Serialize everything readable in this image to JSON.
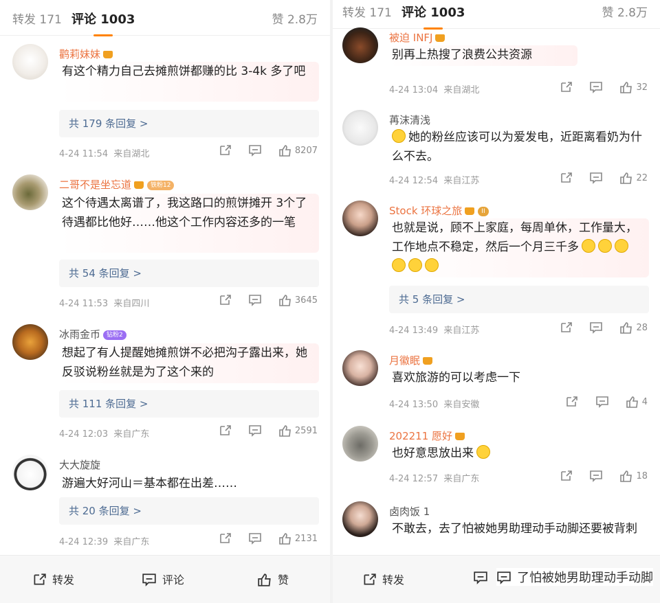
{
  "left": {
    "tabs": {
      "repost": "转发 171",
      "comments": "评论 1003",
      "likes": "赞 2.8万"
    },
    "comments": [
      {
        "user": "鹳莉妹妹",
        "text": "有这个精力自己去摊煎饼都赚的比 3-4k 多了吧",
        "replies": "共 179 条回复 >",
        "time": "4-24 11:54",
        "from": "来自湖北",
        "likes": "8207"
      },
      {
        "user": "二哥不是坐忘道",
        "badge": "铁粉12",
        "text": "这个待遇太离谱了，我这路口的煎饼摊开 3个了待遇都比他好……他这个工作内容还多的一笔",
        "replies": "共 54 条回复 >",
        "time": "4-24 11:53",
        "from": "来自四川",
        "likes": "3645"
      },
      {
        "user": "冰雨金币",
        "badge": "钻粉2",
        "text": "想起了有人提醒她摊煎饼不必把沟子露出来，她反驳说粉丝就是为了这个来的",
        "replies": "共 111 条回复 >",
        "time": "4-24 12:03",
        "from": "来自广东",
        "likes": "2591"
      },
      {
        "user": "大大旋旋",
        "text": "游遍大好河山＝基本都在出差……",
        "replies": "共 20 条回复 >",
        "time": "4-24 12:39",
        "from": "来自广东",
        "likes": "2131"
      }
    ],
    "footer": {
      "repost": "转发",
      "comment": "评论",
      "like": "赞"
    }
  },
  "right": {
    "tabs": {
      "repost": "转发 171",
      "comments": "评论 1003",
      "likes": "赞 2.8万"
    },
    "comments": [
      {
        "user": "被迫 INFJ",
        "text": "别再上热搜了浪费公共资源",
        "time": "4-24 13:04",
        "from": "来自湖北",
        "likes": "32"
      },
      {
        "user": "苒沫清浅",
        "text": "她的粉丝应该可以为爱发电，近距离看奶为什么不去。",
        "time": "4-24 12:54",
        "from": "来自江苏",
        "likes": "22"
      },
      {
        "user": "Stock 环球之旅",
        "badge": "II",
        "text": "也就是说，顾不上家庭，每周单休，工作量大，工作地点不稳定，然后一个月三千多",
        "replies": "共 5 条回复 >",
        "time": "4-24 13:49",
        "from": "来自江苏",
        "likes": "28"
      },
      {
        "user": "月徽眠",
        "text": "喜欢旅游的可以考虑一下",
        "time": "4-24 13:50",
        "from": "来自安徽",
        "likes": "4"
      },
      {
        "user": "202211 愿好",
        "text": "也好意思放出来",
        "time": "4-24 12:57",
        "from": "来自广东",
        "likes": "18"
      },
      {
        "user": "卤肉饭 1",
        "text": "不敢去，去了怕被她男助理动手动脚还要被背刺"
      }
    ],
    "footer": {
      "repost": "转发",
      "comment_preview": "了怕被她男助理动手动脚"
    }
  },
  "colors": {
    "accent": "#ff8200",
    "username_orange": "#eb7340",
    "reply_link": "#4d6b92",
    "meta_gray": "#9a9a9a"
  },
  "icons": [
    "share-icon",
    "comment-icon",
    "thumbs-up-icon",
    "crown-icon",
    "smile-emoji-icon"
  ]
}
